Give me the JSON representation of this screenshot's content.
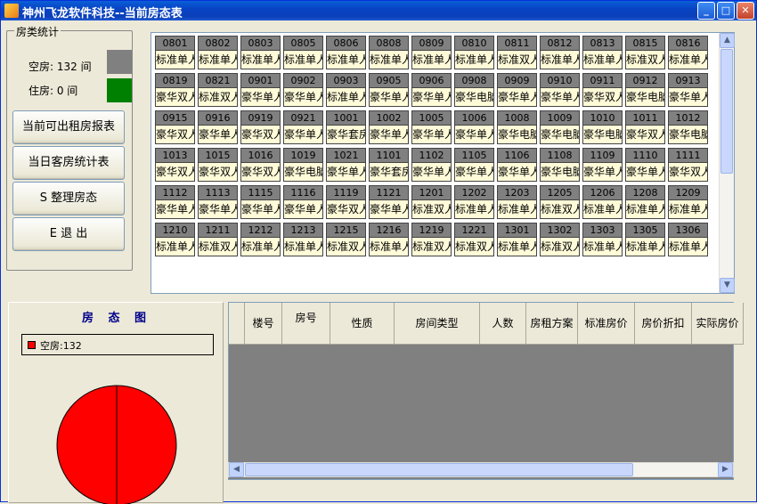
{
  "window": {
    "title": "神州飞龙软件科技--当前房态表"
  },
  "stats": {
    "group_label": "房类统计",
    "vacant_label": "空房",
    "vacant_count": "132",
    "occupied_label": "住房",
    "occupied_count": "0",
    "unit": "间",
    "vacant_text": "空房: 132 间",
    "occupied_text": "住房: 0 间",
    "vacant_color": "#808080",
    "occupied_color": "#008000"
  },
  "buttons": {
    "rentable_report": "当前可出租房报表",
    "daily_guest_report": "当日客房统计表",
    "tidy_rooms": "S 整理房态",
    "exit": "E 退    出"
  },
  "rooms": [
    {
      "no": "0801",
      "type": "标准单人间"
    },
    {
      "no": "0802",
      "type": "标准单人间"
    },
    {
      "no": "0803",
      "type": "标准单人间"
    },
    {
      "no": "0805",
      "type": "标准单人间"
    },
    {
      "no": "0806",
      "type": "标准单人间"
    },
    {
      "no": "0808",
      "type": "标准单人间"
    },
    {
      "no": "0809",
      "type": "标准单人间"
    },
    {
      "no": "0810",
      "type": "标准单人间"
    },
    {
      "no": "0811",
      "type": "标准双人间"
    },
    {
      "no": "0812",
      "type": "标准单人间"
    },
    {
      "no": "0813",
      "type": "标准单人间"
    },
    {
      "no": "0815",
      "type": "标准双人间"
    },
    {
      "no": "0816",
      "type": "标准单人间"
    },
    {
      "no": "0819",
      "type": "豪华双人间"
    },
    {
      "no": "0821",
      "type": "标准双人间"
    },
    {
      "no": "0901",
      "type": "豪华单人间"
    },
    {
      "no": "0902",
      "type": "豪华单人间"
    },
    {
      "no": "0903",
      "type": "标准单人间"
    },
    {
      "no": "0905",
      "type": "豪华单人间"
    },
    {
      "no": "0906",
      "type": "豪华单人间"
    },
    {
      "no": "0908",
      "type": "豪华电脑单间"
    },
    {
      "no": "0909",
      "type": "豪华单人间"
    },
    {
      "no": "0910",
      "type": "豪华单人间"
    },
    {
      "no": "0911",
      "type": "豪华双人间"
    },
    {
      "no": "0912",
      "type": "豪华电脑单间"
    },
    {
      "no": "0913",
      "type": "豪华单人间"
    },
    {
      "no": "0915",
      "type": "豪华双人间"
    },
    {
      "no": "0916",
      "type": "豪华单人间"
    },
    {
      "no": "0919",
      "type": "豪华双人间"
    },
    {
      "no": "0921",
      "type": "豪华单人间"
    },
    {
      "no": "1001",
      "type": "豪华套房"
    },
    {
      "no": "1002",
      "type": "豪华单人间"
    },
    {
      "no": "1005",
      "type": "豪华单人间"
    },
    {
      "no": "1006",
      "type": "豪华单人间"
    },
    {
      "no": "1008",
      "type": "豪华电脑单间"
    },
    {
      "no": "1009",
      "type": "豪华电脑单间"
    },
    {
      "no": "1010",
      "type": "豪华电脑单间"
    },
    {
      "no": "1011",
      "type": "豪华双人间"
    },
    {
      "no": "1012",
      "type": "豪华电脑单间"
    },
    {
      "no": "1013",
      "type": "豪华双人间"
    },
    {
      "no": "1015",
      "type": "豪华双人间"
    },
    {
      "no": "1016",
      "type": "豪华双人间"
    },
    {
      "no": "1019",
      "type": "豪华电脑双间"
    },
    {
      "no": "1021",
      "type": "豪华单人间"
    },
    {
      "no": "1101",
      "type": "豪华套房"
    },
    {
      "no": "1102",
      "type": "豪华单人间"
    },
    {
      "no": "1105",
      "type": "豪华单人间"
    },
    {
      "no": "1106",
      "type": "豪华单人间"
    },
    {
      "no": "1108",
      "type": "豪华电脑单间"
    },
    {
      "no": "1109",
      "type": "豪华单人间"
    },
    {
      "no": "1110",
      "type": "豪华单人间"
    },
    {
      "no": "1111",
      "type": "豪华双人间"
    },
    {
      "no": "1112",
      "type": "豪华单人间"
    },
    {
      "no": "1113",
      "type": "豪华单人间"
    },
    {
      "no": "1115",
      "type": "豪华单人间"
    },
    {
      "no": "1116",
      "type": "豪华单人间"
    },
    {
      "no": "1119",
      "type": "豪华双人间"
    },
    {
      "no": "1121",
      "type": "豪华单人间"
    },
    {
      "no": "1201",
      "type": "标准双人间"
    },
    {
      "no": "1202",
      "type": "标准单人间"
    },
    {
      "no": "1203",
      "type": "标准单人间"
    },
    {
      "no": "1205",
      "type": "标准双人间"
    },
    {
      "no": "1206",
      "type": "标准单人间"
    },
    {
      "no": "1208",
      "type": "标准单人间"
    },
    {
      "no": "1209",
      "type": "标准单人间"
    },
    {
      "no": "1210",
      "type": "标准单人间"
    },
    {
      "no": "1211",
      "type": "标准双人间"
    },
    {
      "no": "1212",
      "type": "标准单人间"
    },
    {
      "no": "1213",
      "type": "标准单人间"
    },
    {
      "no": "1215",
      "type": "标准双人间"
    },
    {
      "no": "1216",
      "type": "标准单人间"
    },
    {
      "no": "1219",
      "type": "标准双人间"
    },
    {
      "no": "1221",
      "type": "标准双人间"
    },
    {
      "no": "1301",
      "type": "标准单人间"
    },
    {
      "no": "1302",
      "type": "标准双人间"
    },
    {
      "no": "1303",
      "type": "标准单人间"
    },
    {
      "no": "1305",
      "type": "标准单人间"
    },
    {
      "no": "1306",
      "type": "标准单人间"
    }
  ],
  "status_chart": {
    "title": "房 态 图",
    "legend": "空房:132",
    "slice_color": "#ff0000"
  },
  "table": {
    "columns": [
      "楼号",
      "房号",
      "性质",
      "房间类型",
      "人数",
      "房租方案",
      "标准房价",
      "房价折扣",
      "实际房价"
    ]
  }
}
